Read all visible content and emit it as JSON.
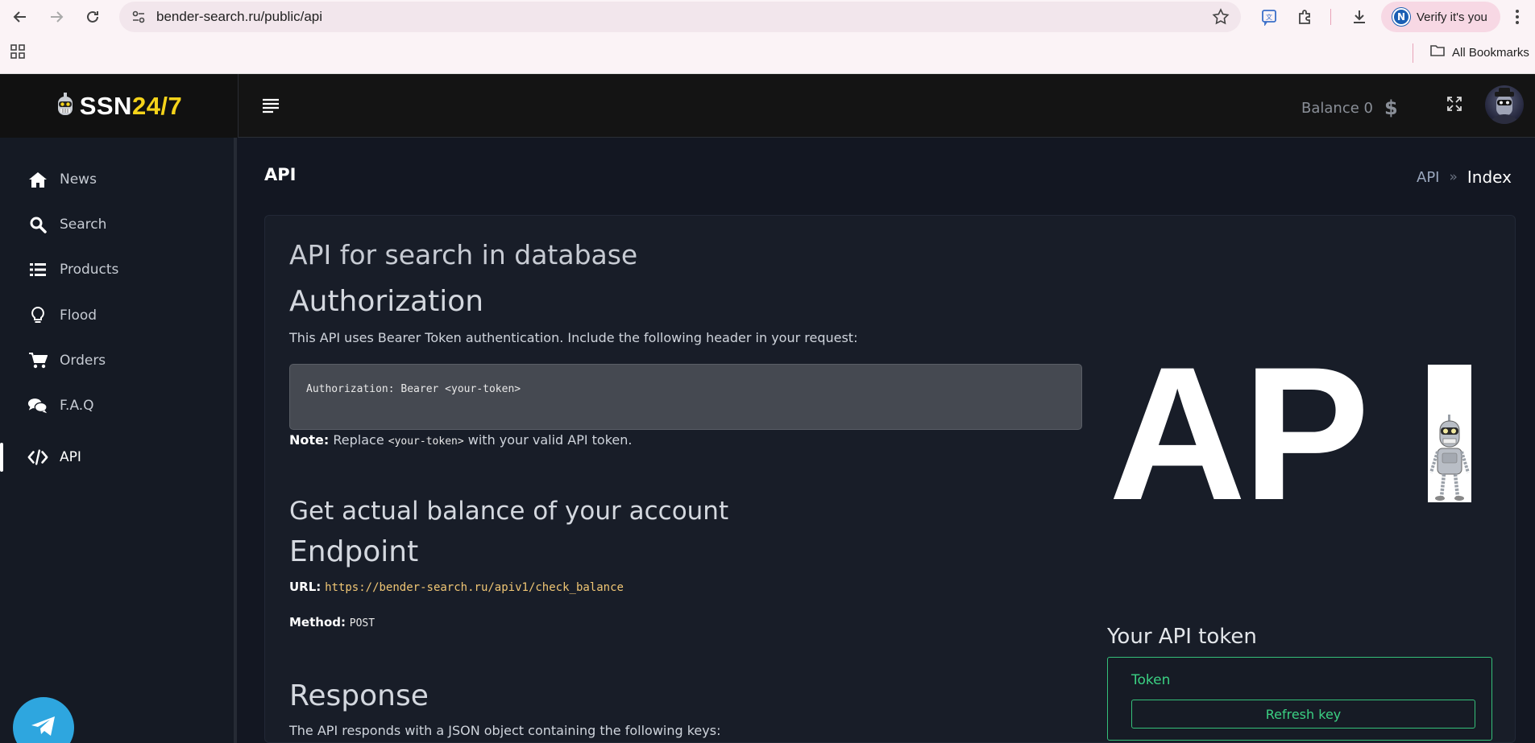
{
  "browser": {
    "url": "bender-search.ru/public/api",
    "verify_label": "Verify it's you",
    "verify_badge": "N",
    "all_bookmarks": "All Bookmarks"
  },
  "header": {
    "logo_main": "SSN",
    "logo_accent": "24/7",
    "balance_label": "Balance 0",
    "currency_symbol": "$"
  },
  "sidebar": {
    "items": [
      {
        "label": "News",
        "icon": "home-icon"
      },
      {
        "label": "Search",
        "icon": "search-icon"
      },
      {
        "label": "Products",
        "icon": "list-icon"
      },
      {
        "label": "Flood",
        "icon": "lightbulb-icon"
      },
      {
        "label": "Orders",
        "icon": "cart-icon"
      },
      {
        "label": "F.A.Q",
        "icon": "comments-icon"
      },
      {
        "label": "API",
        "icon": "code-icon",
        "active": true
      }
    ]
  },
  "page": {
    "title": "API",
    "breadcrumb": {
      "link": "API",
      "separator": "»",
      "current": "Index"
    }
  },
  "content": {
    "main_heading": "API for search in database",
    "auth_heading": "Authorization",
    "auth_text": "This API uses Bearer Token authentication. Include the following header in your request:",
    "auth_code": "Authorization: Bearer <your-token>",
    "note_label": "Note:",
    "note_pre": " Replace ",
    "note_code": "<your-token>",
    "note_post": " with your valid API token.",
    "balance_heading": "Get actual balance of your account",
    "endpoint_heading": "Endpoint",
    "url_label": "URL:",
    "url_value": "https://bender-search.ru/apiv1/check_balance",
    "method_label": "Method:",
    "method_value": "POST",
    "response_heading": "Response",
    "response_text": "The API responds with a JSON object containing the following keys:"
  },
  "api_image": {
    "letters": "AP"
  },
  "token": {
    "title": "Your API token",
    "label": "Token",
    "refresh_button": "Refresh key"
  }
}
